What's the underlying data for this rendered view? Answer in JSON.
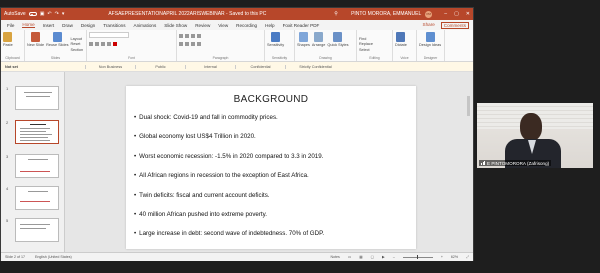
{
  "title_bar": {
    "autosave_label": "AutoSave",
    "autosave_state": "Off",
    "doc_title": "AFSAEPRESENTATIONAPRIL 2022ARISWEBINAR  -  Saved to this PC",
    "user_name": "PINTO MORORA, EMMANUEL",
    "user_initials": "PM"
  },
  "menu_tabs": [
    "File",
    "Home",
    "Insert",
    "Draw",
    "Design",
    "Transitions",
    "Animations",
    "Slide Show",
    "Review",
    "View",
    "Recording",
    "Help",
    "Foxit Reader PDF"
  ],
  "menu_right": {
    "share": "Share",
    "comments": "Comments"
  },
  "ribbon": {
    "clipboard": {
      "paste": "Paste",
      "label": "Clipboard"
    },
    "slides": {
      "new_slide": "New Slide",
      "reuse": "Reuse Slides",
      "layout": "Layout",
      "reset": "Reset",
      "section": "Section",
      "label": "Slides"
    },
    "font": {
      "label": "Font"
    },
    "paragraph": {
      "label": "Paragraph"
    },
    "sensitivity": {
      "btn": "Sensitivity",
      "label": "Sensitivity"
    },
    "drawing": {
      "shapes": "Shapes",
      "arrange": "Arrange",
      "quick_styles": "Quick Styles",
      "label": "Drawing"
    },
    "editing": {
      "find": "Find",
      "replace": "Replace",
      "select": "Select",
      "label": "Editing"
    },
    "voice": {
      "dictate": "Dictate",
      "label": "Voice"
    },
    "designer": {
      "ideas": "Design Ideas",
      "label": "Designer"
    }
  },
  "sensitivity_bar": {
    "label": "Not set",
    "options": [
      "Non Business",
      "Public",
      "Internal",
      "Confidential",
      "Strictly Confidential"
    ]
  },
  "thumbnails": [
    {
      "num": "1"
    },
    {
      "num": "2"
    },
    {
      "num": "3"
    },
    {
      "num": "4"
    },
    {
      "num": "5"
    }
  ],
  "slide": {
    "title": "BACKGROUND",
    "bullets": [
      "Dual shock: Covid-19 and fall in commodity prices.",
      "Global economy lost US$4 Trillion in 2020.",
      "Worst economic recession: -1.5% in 2020 compared to 3.3 in 2019.",
      "All African regions in recession to the exception of East Africa.",
      "Twin deficits: fiscal and current account deficits.",
      "40 million African pushed into extreme poverty.",
      "Large increase in debt: second wave of indebtedness. 70% of GDP."
    ]
  },
  "status_bar": {
    "slide_of": "Slide 2 of 17",
    "language": "English (United States)",
    "notes": "Notes",
    "zoom": "62%"
  },
  "participant": {
    "name": "E PINTOMORORA (Zafrisong)"
  }
}
